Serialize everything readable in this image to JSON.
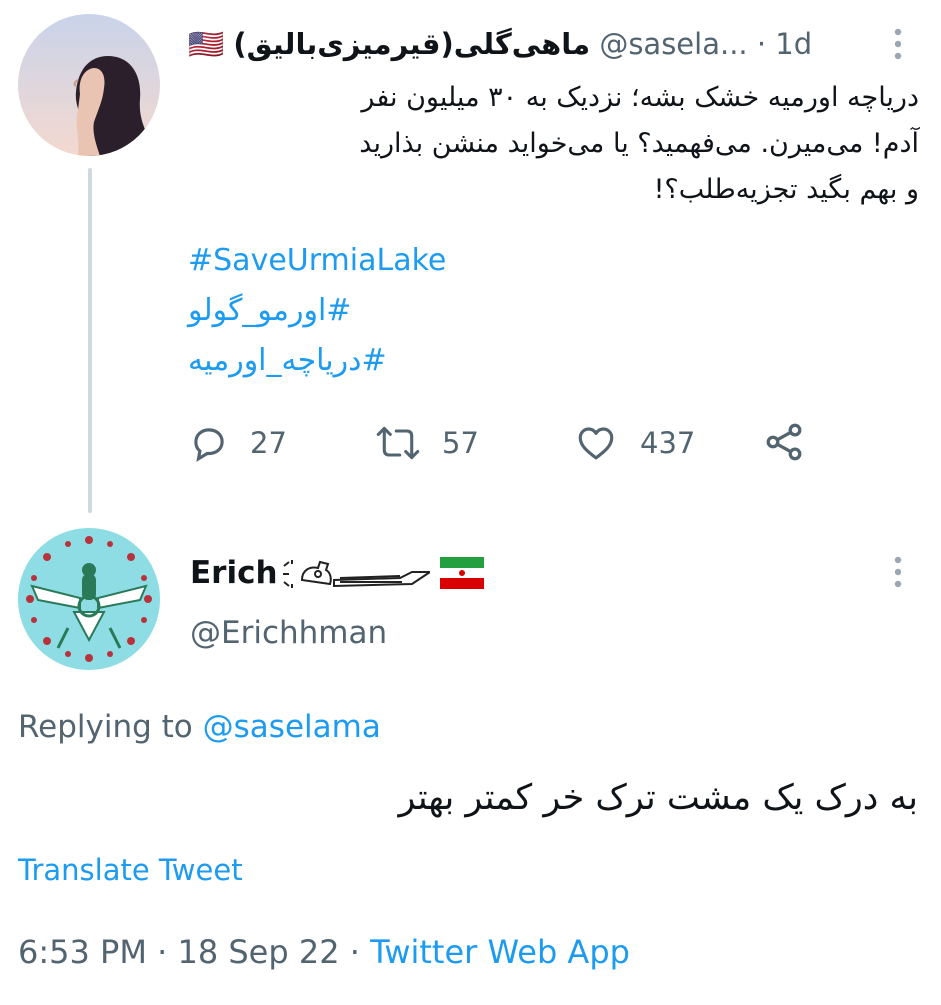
{
  "thread_tweet": {
    "display_name": "ماهی‌گلی(قیرمیزی‌بالیق)",
    "flag": "🇺🇸",
    "handle": "@sasela...",
    "separator": "·",
    "time": "1d",
    "body_lines": [
      "دریاچه اورمیه خشک بشه؛ نزدیک به ۳۰ میلیون نفر",
      "آدم! می‌میرن. می‌فهمید؟ یا می‌خواید منشن بذارید",
      "و بهم بگید تجزیه‌طلب؟!"
    ],
    "hashtags": [
      "#SaveUrmiaLake",
      "#اورمو_گولو",
      "#دریاچه_اورمیه"
    ],
    "stats": {
      "replies": "27",
      "retweets": "57",
      "likes": "437"
    }
  },
  "reply_tweet": {
    "display_name": "Erich",
    "handle": "@Erichhman",
    "replying_prefix": "Replying to",
    "replying_to": "@saselama",
    "body": "به درک یک مشت ترک خر کمتر بهتر",
    "translate_label": "Translate Tweet",
    "time": "6:53 PM",
    "date": "18 Sep 22",
    "source": "Twitter Web App",
    "separator": "·"
  },
  "icons": {
    "reply": "reply-icon",
    "retweet": "retweet-icon",
    "like": "heart-icon",
    "share": "share-icon",
    "more": "more-vertical-icon"
  },
  "colors": {
    "link": "#1d9bf0",
    "secondary_text": "#536471",
    "thread_line": "#cfd9de"
  }
}
